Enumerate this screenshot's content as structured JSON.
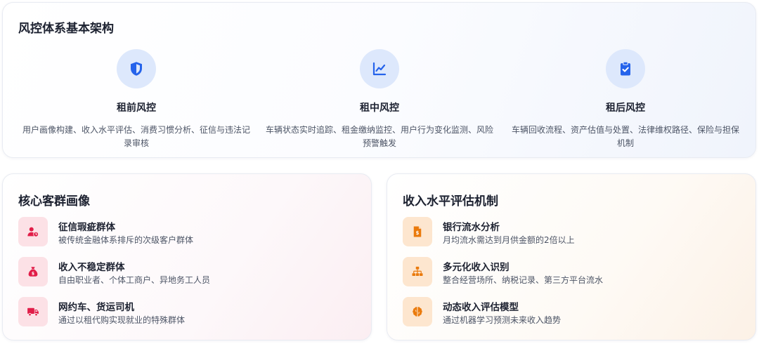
{
  "architecture": {
    "title": "风控体系基本架构",
    "phases": [
      {
        "icon": "shield-icon",
        "title": "租前风控",
        "desc": "用户画像构建、收入水平评估、消费习惯分析、征信与违法记录审核"
      },
      {
        "icon": "line-chart-icon",
        "title": "租中风控",
        "desc": "车辆状态实时追踪、租金缴纳监控、用户行为变化监测、风险预警触发"
      },
      {
        "icon": "clipboard-check-icon",
        "title": "租后风控",
        "desc": "车辆回收流程、资产估值与处置、法律维权路径、保险与担保机制"
      }
    ]
  },
  "customers": {
    "title": "核心客群画像",
    "items": [
      {
        "icon": "user-clock-icon",
        "title": "征信瑕疵群体",
        "desc": "被传统金融体系排斥的次级客户群体"
      },
      {
        "icon": "money-bag-icon",
        "title": "收入不稳定群体",
        "desc": "自由职业者、个体工商户、异地务工人员"
      },
      {
        "icon": "truck-icon",
        "title": "网约车、货运司机",
        "desc": "通过以租代购实现就业的特殊群体"
      }
    ]
  },
  "income": {
    "title": "收入水平评估机制",
    "items": [
      {
        "icon": "invoice-dollar-icon",
        "title": "银行流水分析",
        "desc": "月均流水需达到月供金额的2倍以上"
      },
      {
        "icon": "sitemap-icon",
        "title": "多元化收入识别",
        "desc": "整合经营场所、纳税记录、第三方平台流水"
      },
      {
        "icon": "brain-icon",
        "title": "动态收入评估模型",
        "desc": "通过机器学习预测未来收入趋势"
      }
    ]
  },
  "colors": {
    "blue_accent": "#2563eb",
    "blue_icon_bg": "#dde8fc",
    "red_accent": "#e11d48",
    "red_icon_bg": "#fce1e6",
    "orange_accent": "#ea7a0c",
    "orange_icon_bg": "#fde6cf"
  }
}
